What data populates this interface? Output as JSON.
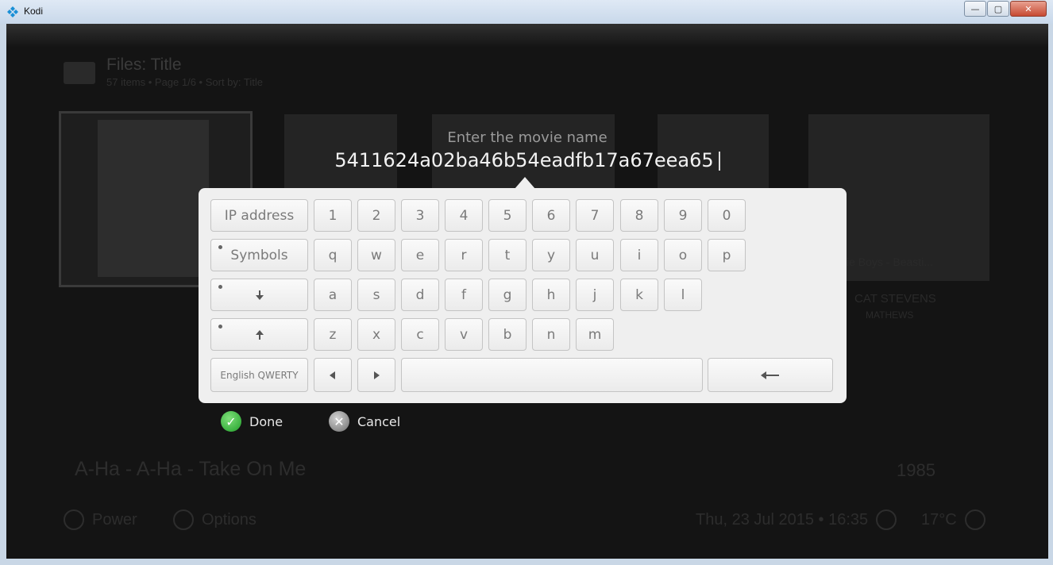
{
  "window": {
    "title": "Kodi",
    "minimize_glyph": "—",
    "maximize_glyph": "▢",
    "close_glyph": "✕",
    "accent_color": "#1a8fd6"
  },
  "background": {
    "header_title": "Files: Title",
    "header_subtitle": "57 items • Page 1/6 • Sort by: Title",
    "item_caption_right": "ie Boys - Beasti...",
    "album_text": "CAT STEVENS",
    "album_subtext": "MATHEWS",
    "now_playing": "A-Ha - A-Ha - Take On Me",
    "year": "1985",
    "footer_power": "Power",
    "footer_options": "Options",
    "footer_datetime": "Thu, 23 Jul 2015 • 16:35",
    "footer_temperature": "17°C"
  },
  "prompt": {
    "heading": "Enter the movie name",
    "value": "5411624a02ba46b54eadfb17a67eea65"
  },
  "keyboard": {
    "ip_address_label": "IP address",
    "symbols_label": "Symbols",
    "layout_label": "English QWERTY",
    "row_numbers": [
      "1",
      "2",
      "3",
      "4",
      "5",
      "6",
      "7",
      "8",
      "9",
      "0"
    ],
    "row_q": [
      "q",
      "w",
      "e",
      "r",
      "t",
      "y",
      "u",
      "i",
      "o",
      "p"
    ],
    "row_a": [
      "a",
      "s",
      "d",
      "f",
      "g",
      "h",
      "j",
      "k",
      "l"
    ],
    "row_z": [
      "z",
      "x",
      "c",
      "v",
      "b",
      "n",
      "m"
    ],
    "shift_down_icon": "down-arrow-icon",
    "shift_up_icon": "up-arrow-icon",
    "left_icon": "left-triangle-icon",
    "right_icon": "right-triangle-icon",
    "backspace_icon": "backspace-arrow-icon"
  },
  "buttons": {
    "done_label": "Done",
    "cancel_label": "Cancel"
  }
}
